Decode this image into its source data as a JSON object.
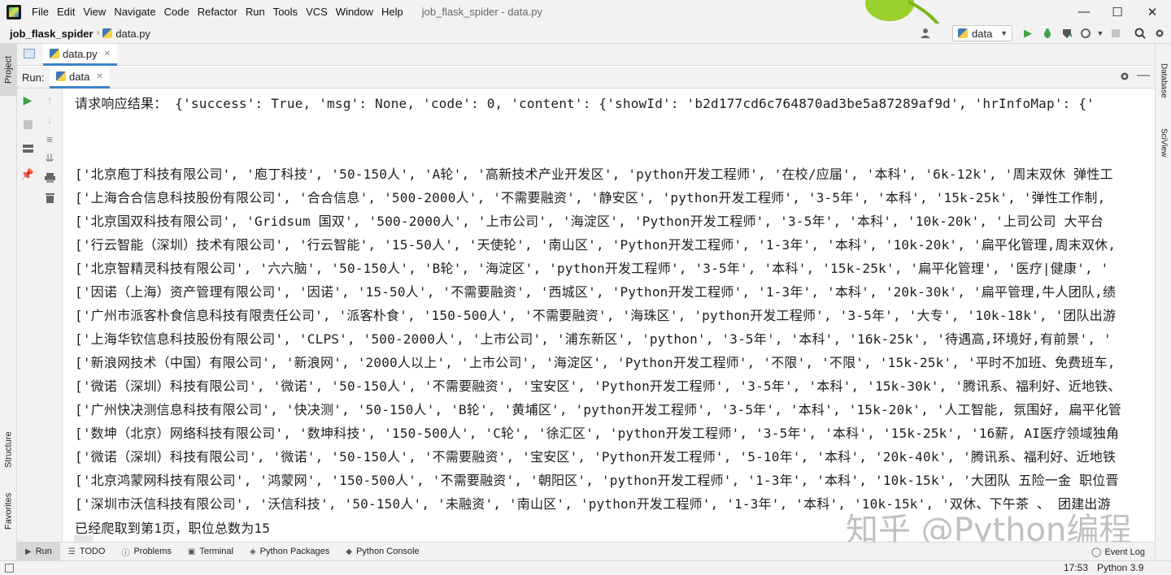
{
  "menu": [
    "File",
    "Edit",
    "View",
    "Navigate",
    "Code",
    "Refactor",
    "Run",
    "Tools",
    "VCS",
    "Window",
    "Help"
  ],
  "window_title": "job_flask_spider - data.py",
  "window_controls": {
    "minimize": "—",
    "maximize": "☐",
    "close": "✕"
  },
  "breadcrumb": {
    "project": "job_flask_spider",
    "file": "data.py"
  },
  "run_config": {
    "name": "data"
  },
  "left_strip": {
    "project": "Project",
    "structure": "Structure",
    "favorites": "Favorites"
  },
  "right_strip": {
    "database": "Database",
    "sciview": "SciView"
  },
  "editor_tab": {
    "label": "data.py"
  },
  "run_window": {
    "label": "Run:",
    "tab": "data"
  },
  "console_lines": [
    "请求响应结果： {'success': True, 'msg': None, 'code': 0, 'content': {'showId': 'b2d177cd6c764870ad3be5a87289af9d', 'hrInfoMap': {'",
    "['北京庖丁科技有限公司', '庖丁科技', '50-150人', 'A轮', '高新技术产业开发区', 'python开发工程师', '在校/应届', '本科', '6k-12k', '周末双休 弹性工",
    "['上海合合信息科技股份有限公司', '合合信息', '500-2000人', '不需要融资', '静安区', 'python开发工程师', '3-5年', '本科', '15k-25k', '弹性工作制,",
    "['北京国双科技有限公司', 'Gridsum 国双', '500-2000人', '上市公司', '海淀区', 'Python开发工程师', '3-5年', '本科', '10k-20k', '上司公司 大平台",
    "['行云智能（深圳）技术有限公司', '行云智能', '15-50人', '天使轮', '南山区', 'Python开发工程师', '1-3年', '本科', '10k-20k', '扁平化管理,周末双休,",
    "['北京智精灵科技有限公司', '六六脑', '50-150人', 'B轮', '海淀区', 'python开发工程师', '3-5年', '本科', '15k-25k', '扁平化管理', '医疗|健康', '",
    "['因诺（上海）资产管理有限公司', '因诺', '15-50人', '不需要融资', '西城区', 'Python开发工程师', '1-3年', '本科', '20k-30k', '扁平管理,牛人团队,绩",
    "['广州市派客朴食信息科技有限责任公司', '派客朴食', '150-500人', '不需要融资', '海珠区', 'python开发工程师', '3-5年', '大专', '10k-18k', '团队出游",
    "['上海华钦信息科技股份有限公司', 'CLPS', '500-2000人', '上市公司', '浦东新区', 'python', '3-5年', '本科', '16k-25k', '待遇高,环境好,有前景', '",
    "['新浪网技术（中国）有限公司', '新浪网', '2000人以上', '上市公司', '海淀区', 'Python开发工程师', '不限', '不限', '15k-25k', '平时不加班、免费班车,",
    "['微诺（深圳）科技有限公司', '微诺', '50-150人', '不需要融资', '宝安区', 'Python开发工程师', '3-5年', '本科', '15k-30k', '腾讯系、福利好、近地铁、",
    "['广州快决测信息科技有限公司', '快决测', '50-150人', 'B轮', '黄埔区', 'python开发工程师', '3-5年', '本科', '15k-20k', '人工智能, 氛围好, 扁平化管",
    "['数坤（北京）网络科技有限公司', '数坤科技', '150-500人', 'C轮', '徐汇区', 'python开发工程师', '3-5年', '本科', '15k-25k', '16薪, AI医疗领域独角",
    "['微诺（深圳）科技有限公司', '微诺', '50-150人', '不需要融资', '宝安区', 'Python开发工程师', '5-10年', '本科', '20k-40k', '腾讯系、福利好、近地铁",
    "['北京鸿蒙网科技有限公司', '鸿蒙网', '150-500人', '不需要融资', '朝阳区', 'python开发工程师', '1-3年', '本科', '10k-15k', '大团队 五险一金 职位晋",
    "['深圳市沃信科技有限公司', '沃信科技', '50-150人', '未融资', '南山区', 'python开发工程师', '1-3年', '本科', '10k-15k', '双休、下午茶 、 团建出游",
    "已经爬取到第1页，职位总数为15"
  ],
  "watermark": "知乎 @Python编程",
  "tool_tabs": [
    "Run",
    "TODO",
    "Problems",
    "Terminal",
    "Python Packages",
    "Python Console"
  ],
  "event_log": "Event Log",
  "status": {
    "time": "17:53",
    "interpreter": "Python 3.9"
  },
  "colors": {
    "accent": "#4083c9",
    "run_green": "#3fa14a",
    "toolbar_bg": "#f2f2f2"
  }
}
